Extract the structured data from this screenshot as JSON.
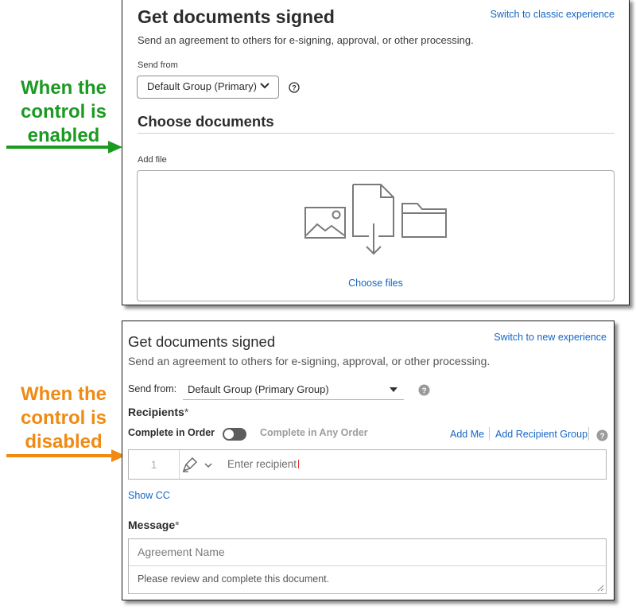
{
  "callouts": {
    "enabled_lines": [
      "When the",
      "control is",
      "enabled"
    ],
    "disabled_lines": [
      "When the",
      "control is",
      "disabled"
    ],
    "enabled_color": "#1b9a22",
    "disabled_color": "#f08a12"
  },
  "enabled_view": {
    "title": "Get documents signed",
    "subtitle": "Send an agreement to others for e-signing, approval, or other processing.",
    "switch_link": "Switch to classic experience",
    "send_from_label": "Send from",
    "send_from_value": "Default Group (Primary)",
    "choose_heading": "Choose documents",
    "add_file_label": "Add file",
    "choose_files_link": "Choose files",
    "icons": [
      "chevron-down-icon",
      "help-icon",
      "image-icon",
      "document-upload-icon",
      "folder-icon"
    ]
  },
  "disabled_view": {
    "title": "Get documents signed",
    "subtitle": "Send an agreement to others for e-signing, approval, or other processing.",
    "switch_link": "Switch to new experience",
    "send_from_label": "Send from:",
    "send_from_value": "Default Group (Primary Group)",
    "recipients_label": "Recipients",
    "required_mark": "*",
    "complete_in_order": "Complete in Order",
    "complete_any_order": "Complete in Any Order",
    "toggle_on": false,
    "add_me": "Add Me",
    "add_recipient_group": "Add Recipient Group",
    "recipient_number": "1",
    "recipient_placeholder": "Enter recipient",
    "show_cc": "Show CC",
    "message_label": "Message",
    "agreement_name_placeholder": "Agreement Name",
    "message_body": "Please review and complete this document.",
    "link_color": "#1466c6"
  }
}
